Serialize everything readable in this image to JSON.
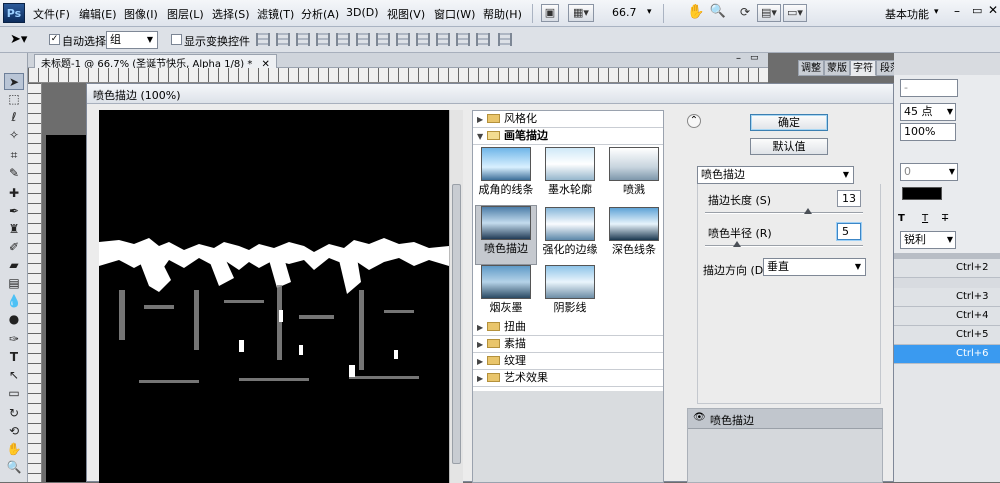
{
  "menubar": {
    "logo": "Ps",
    "items": [
      "文件(F)",
      "编辑(E)",
      "图像(I)",
      "图层(L)",
      "选择(S)",
      "滤镜(T)",
      "分析(A)",
      "3D(D)",
      "视图(V)",
      "窗口(W)",
      "帮助(H)"
    ],
    "zoom": "66.7",
    "workspace": "基本功能"
  },
  "options": {
    "auto_select_label": "自动选择:",
    "auto_select_value": "组",
    "show_transform_label": "显示变换控件"
  },
  "document": {
    "tab_title": "未标题-1 @ 66.7% (圣诞节快乐, Alpha 1/8) *"
  },
  "dialog": {
    "title": "喷色描边 (100%)",
    "categories_top": [
      {
        "label": "风格化",
        "expanded": false
      },
      {
        "label": "画笔描边",
        "expanded": true
      }
    ],
    "filters": [
      "成角的线条",
      "墨水轮廓",
      "喷溅",
      "喷色描边",
      "强化的边缘",
      "深色线条",
      "烟灰墨",
      "阴影线"
    ],
    "active_filter_index": 3,
    "categories_bottom": [
      "扭曲",
      "素描",
      "纹理",
      "艺术效果"
    ],
    "ok_label": "确定",
    "default_label": "默认值",
    "filter_select": "喷色描边",
    "stroke_length_label": "描边长度 (S)",
    "stroke_length_value": "13",
    "stroke_length_fraction": 0.65,
    "spray_radius_label": "喷色半径 (R)",
    "spray_radius_value": "5",
    "spray_radius_fraction": 0.2,
    "direction_label": "描边方向 (D):",
    "direction_value": "垂直",
    "layer_item": "喷色描边"
  },
  "panels": {
    "tabs": [
      "调整",
      "蒙版",
      "字符",
      "段落"
    ],
    "active_tab": "字符",
    "font_size": "45 点",
    "tracking_percent": "100%",
    "kerning": "0",
    "antialias": "锐利",
    "shortcuts": [
      "Ctrl+2",
      "Ctrl+3",
      "Ctrl+4",
      "Ctrl+5",
      "Ctrl+6"
    ],
    "active_shortcut_index": 4
  }
}
